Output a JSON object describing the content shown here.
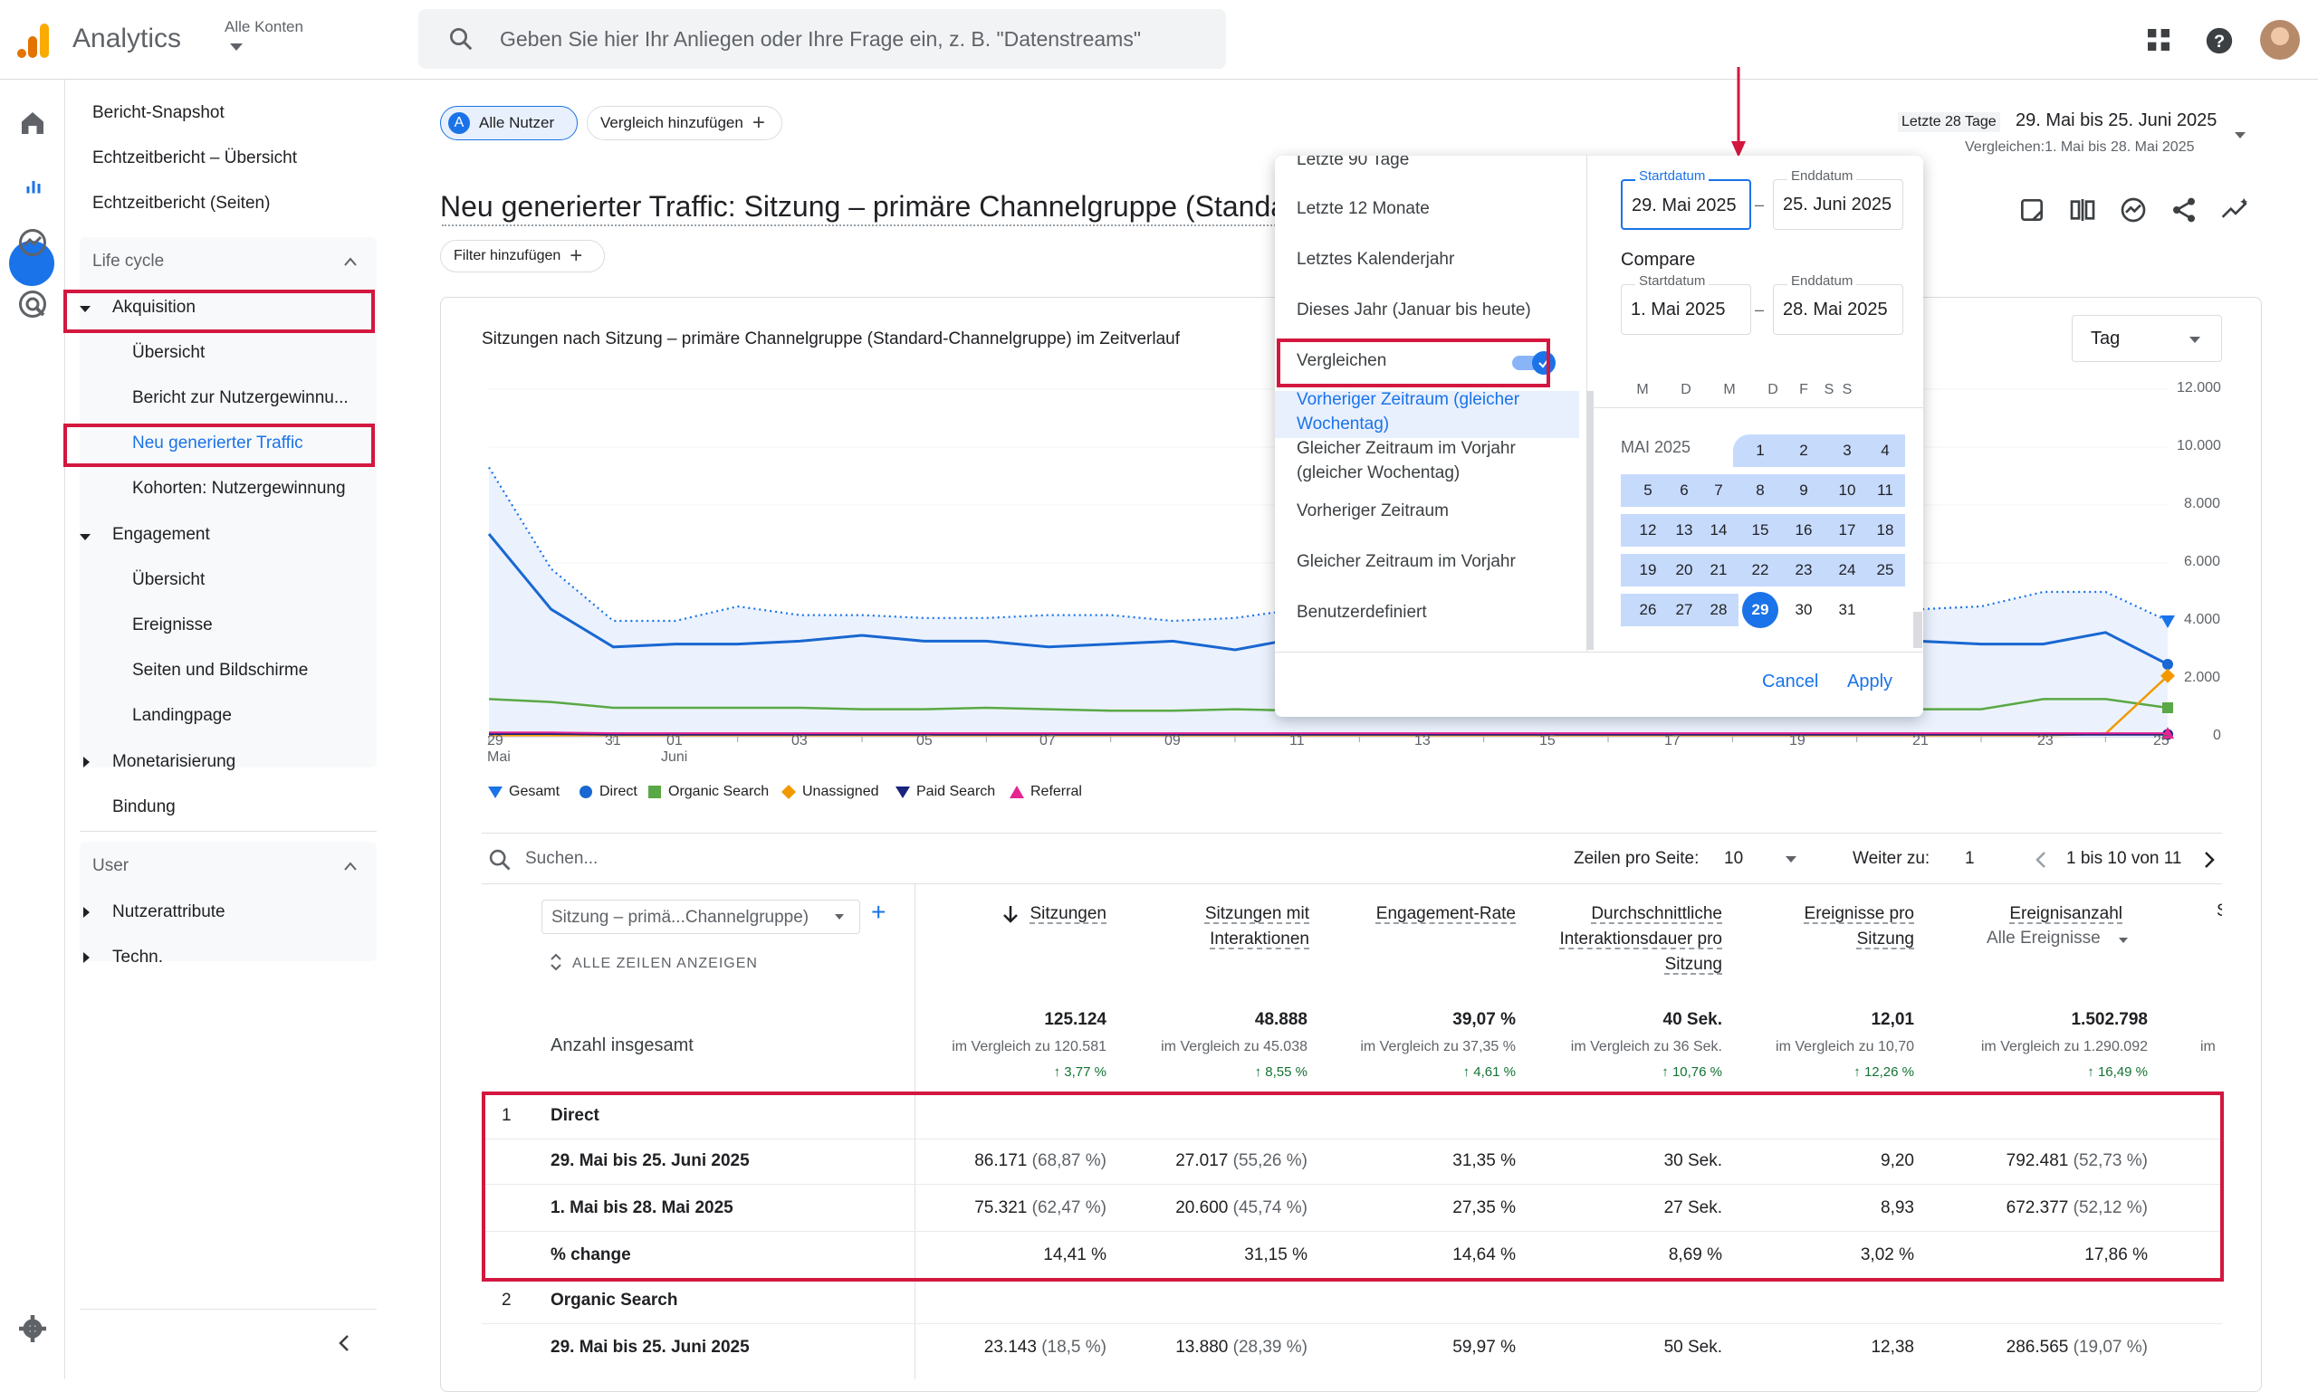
{
  "header": {
    "app_title": "Analytics",
    "account_label": "Alle Konten",
    "search_placeholder": "Geben Sie hier Ihr Anliegen oder Ihre Frage ein, z. B. \"Datenstreams\""
  },
  "sidebar": {
    "top_items": [
      "Bericht-Snapshot",
      "Echtzeitbericht – Übersicht",
      "Echtzeitbericht (Seiten)"
    ],
    "section_lifecycle": "Life cycle",
    "acquisition": "Akquisition",
    "acquisition_items": [
      "Übersicht",
      "Bericht zur Nutzergewinnu...",
      "Neu generierter Traffic",
      "Kohorten: Nutzergewinnung"
    ],
    "engagement": "Engagement",
    "engagement_items": [
      "Übersicht",
      "Ereignisse",
      "Seiten und Bildschirme",
      "Landingpage"
    ],
    "monetization": "Monetarisierung",
    "retention": "Bindung",
    "section_user": "User",
    "user_attributes": "Nutzerattribute",
    "tech": "Techn."
  },
  "comparison": {
    "segment_badge": "A",
    "segment_label": "Alle Nutzer",
    "add_comparison": "Vergleich hinzufügen"
  },
  "date_range": {
    "preset_label": "Letzte 28 Tage",
    "range": "29. Mai bis 25. Juni 2025",
    "compare": "Vergleichen:1. Mai bis 28. Mai 2025"
  },
  "page": {
    "title": "Neu generierter Traffic: Sitzung – primäre Channelgruppe (Standard-Channelgruppe)",
    "add_filter": "Filter hinzufügen"
  },
  "chart": {
    "title": "Sitzungen nach Sitzung – primäre Channelgruppe (Standard-Channelgruppe) im Zeitverlauf",
    "granularity": "Tag"
  },
  "chart_data": {
    "type": "line",
    "title": "Sitzungen nach Sitzung – primäre Channelgruppe (Standard-Channelgruppe) im Zeitverlauf",
    "x_tick_labels": [
      "29",
      "31",
      "01",
      "03",
      "05",
      "07",
      "09",
      "11",
      "13",
      "15",
      "17",
      "19",
      "21",
      "23",
      "25"
    ],
    "x_tick_sublabels": [
      "Mai",
      "Juni"
    ],
    "x": [
      "29 Mai",
      "30 Mai",
      "31 Mai",
      "01 Juni",
      "02 Juni",
      "03 Juni",
      "04 Juni",
      "05 Juni",
      "06 Juni",
      "07 Juni",
      "08 Juni",
      "09 Juni",
      "10 Juni",
      "11 Juni",
      "12 Juni",
      "13 Juni",
      "14 Juni",
      "15 Juni",
      "16 Juni",
      "17 Juni",
      "18 Juni",
      "19 Juni",
      "20 Juni",
      "21 Juni",
      "22 Juni",
      "23 Juni",
      "24 Juni",
      "25 Juni"
    ],
    "y_ticks": [
      "12.000",
      "10.000",
      "8.000",
      "6.000",
      "4.000",
      "2.000",
      "0"
    ],
    "ylim": [
      0,
      12000
    ],
    "series": [
      {
        "name": "Gesamt",
        "values": [
          9300,
          5800,
          4000,
          4000,
          4500,
          4200,
          4200,
          4100,
          4100,
          4200,
          4200,
          4000,
          4100,
          4400,
          4300,
          4200,
          4400,
          4100,
          4600,
          4500,
          4400,
          4300,
          4500,
          4400,
          4500,
          5000,
          5000,
          4000
        ]
      },
      {
        "name": "Direct",
        "values": [
          7000,
          4400,
          3100,
          3200,
          3200,
          3300,
          3500,
          3300,
          3300,
          3100,
          3200,
          3300,
          3000,
          3400,
          3400,
          3300,
          3300,
          3200,
          3300,
          3300,
          3300,
          3200,
          3300,
          3300,
          3200,
          3200,
          3600,
          2500
        ]
      },
      {
        "name": "Organic Search",
        "values": [
          1300,
          1200,
          1000,
          1000,
          1000,
          1000,
          950,
          950,
          1000,
          950,
          900,
          900,
          950,
          900,
          950,
          950,
          950,
          950,
          950,
          900,
          1000,
          950,
          950,
          950,
          950,
          1300,
          1300,
          1000
        ]
      },
      {
        "name": "Unassigned",
        "values": [
          50,
          50,
          50,
          50,
          50,
          50,
          50,
          50,
          50,
          50,
          50,
          50,
          50,
          50,
          50,
          50,
          50,
          50,
          50,
          50,
          50,
          50,
          50,
          50,
          50,
          50,
          100,
          2100
        ]
      },
      {
        "name": "Paid Search",
        "values": [
          100,
          100,
          80,
          80,
          80,
          80,
          80,
          80,
          80,
          80,
          80,
          80,
          80,
          80,
          80,
          80,
          80,
          80,
          80,
          80,
          80,
          80,
          80,
          80,
          80,
          80,
          80,
          80
        ]
      },
      {
        "name": "Referral",
        "values": [
          150,
          150,
          120,
          120,
          120,
          120,
          120,
          120,
          120,
          120,
          120,
          120,
          120,
          120,
          120,
          120,
          120,
          120,
          120,
          120,
          120,
          120,
          120,
          120,
          120,
          120,
          120,
          120
        ]
      }
    ],
    "colors": [
      "#1a73e8",
      "#1967d2",
      "#5aa845",
      "#f29900",
      "#1a237e",
      "#e52592"
    ]
  },
  "legend": [
    "Gesamt",
    "Direct",
    "Organic Search",
    "Unassigned",
    "Paid Search",
    "Referral"
  ],
  "date_picker": {
    "options": [
      "Letzte 90 Tage",
      "Letzte 12 Monate",
      "Letztes Kalenderjahr",
      "Dieses Jahr (Januar bis heute)"
    ],
    "compare_label": "Vergleichen",
    "compare_options": [
      "Vorheriger Zeitraum (gleicher Wochentag)",
      "Gleicher Zeitraum im Vorjahr (gleicher Wochentag)",
      "Vorheriger Zeitraum",
      "Gleicher Zeitraum im Vorjahr",
      "Benutzerdefiniert"
    ],
    "start_label": "Startdatum",
    "end_label": "Enddatum",
    "start_value": "29. Mai 2025",
    "end_value": "25. Juni 2025",
    "compare_heading": "Compare",
    "compare_start": "1. Mai 2025",
    "compare_end": "28. Mai 2025",
    "weekdays": [
      "M",
      "D",
      "M",
      "D",
      "F",
      "S",
      "S"
    ],
    "month_label": "MAI 2025",
    "days": [
      "1",
      "2",
      "3",
      "4",
      "5",
      "6",
      "7",
      "8",
      "9",
      "10",
      "11",
      "12",
      "13",
      "14",
      "15",
      "16",
      "17",
      "18",
      "19",
      "20",
      "21",
      "22",
      "23",
      "24",
      "25",
      "26",
      "27",
      "28",
      "29",
      "30",
      "31"
    ],
    "selected_day": "29",
    "cancel": "Cancel",
    "apply": "Apply"
  },
  "table": {
    "search_placeholder": "Suchen...",
    "rows_per_page_label": "Zeilen pro Seite:",
    "rows_per_page": "10",
    "goto_label": "Weiter zu:",
    "goto_value": "1",
    "pagination": "1 bis 10 von 11",
    "dimension_select": "Sitzung – primä...Channelgruppe)",
    "show_all_rows": "ALLE ZEILEN ANZEIGEN",
    "columns": [
      "Sitzungen",
      "Sitzungen mit Interaktionen",
      "Engagement-Rate",
      "Durchschnittliche Interaktionsdauer pro Sitzung",
      "Ereignisse pro Sitzung",
      "Ereignisanzahl"
    ],
    "events_filter": "Alle Ereignisse",
    "totals_label": "Anzahl insgesamt",
    "totals": [
      "125.124",
      "48.888",
      "39,07 %",
      "40 Sek.",
      "12,01",
      "1.502.798"
    ],
    "totals_compare": [
      "im Vergleich zu 120.581",
      "im Vergleich zu 45.038",
      "im Vergleich zu 37,35 %",
      "im Vergleich zu 36 Sek.",
      "im Vergleich zu 10,70",
      "im Vergleich zu 1.290.092",
      "im"
    ],
    "totals_change": [
      "3,77 %",
      "8,55 %",
      "4,61 %",
      "10,76 %",
      "12,26 %",
      "16,49 %"
    ],
    "rows": [
      {
        "idx": "1",
        "label": "Direct"
      },
      {
        "idx": "",
        "label": "29. Mai bis 25. Juni 2025",
        "values": [
          "86.171",
          "27.017",
          "31,35 %",
          "30 Sek.",
          "9,20",
          "792.481"
        ],
        "shares": [
          "(68,87 %)",
          "(55,26 %)",
          "",
          "",
          "",
          "(52,73 %)"
        ]
      },
      {
        "idx": "",
        "label": "1. Mai bis 28. Mai 2025",
        "values": [
          "75.321",
          "20.600",
          "27,35 %",
          "27 Sek.",
          "8,93",
          "672.377"
        ],
        "shares": [
          "(62,47 %)",
          "(45,74 %)",
          "",
          "",
          "",
          "(52,12 %)"
        ]
      },
      {
        "idx": "",
        "label": "% change",
        "values": [
          "14,41 %",
          "31,15 %",
          "14,64 %",
          "8,69 %",
          "3,02 %",
          "17,86 %"
        ],
        "shares": [
          "",
          "",
          "",
          "",
          "",
          ""
        ]
      },
      {
        "idx": "2",
        "label": "Organic Search"
      },
      {
        "idx": "",
        "label": "29. Mai bis 25. Juni 2025",
        "values": [
          "23.143",
          "13.880",
          "59,97 %",
          "50 Sek.",
          "12,38",
          "286.565"
        ],
        "shares": [
          "(18,5 %)",
          "(28,39 %)",
          "",
          "",
          "",
          "(19,07 %)"
        ]
      }
    ]
  }
}
